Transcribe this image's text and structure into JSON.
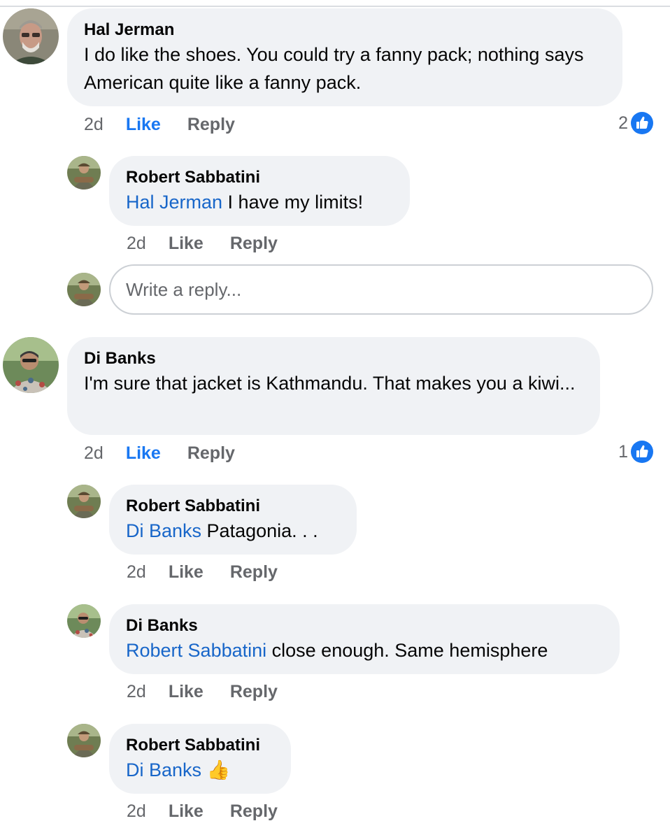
{
  "comments": [
    {
      "author": "Hal Jerman",
      "text": "I do like the shoes. You could try a fanny pack; nothing says American quite like a fanny pack.",
      "time": "2d",
      "like_label": "Like",
      "reply_label": "Reply",
      "reactions": "2",
      "replies": [
        {
          "author": "Robert Sabbatini",
          "mention": "Hal Jerman",
          "text": " I have my limits!",
          "time": "2d",
          "like_label": "Like",
          "reply_label": "Reply"
        }
      ],
      "reply_input_placeholder": "Write a reply..."
    },
    {
      "author": "Di Banks",
      "text": "I'm sure that jacket is Kathmandu. That makes you a kiwi...",
      "time": "2d",
      "like_label": "Like",
      "reply_label": "Reply",
      "reactions": "1",
      "replies": [
        {
          "author": "Robert Sabbatini",
          "mention": "Di Banks",
          "text": " Patagonia. . .",
          "time": "2d",
          "like_label": "Like",
          "reply_label": "Reply"
        },
        {
          "author": "Di Banks",
          "mention": "Robert Sabbatini",
          "text": " close enough. Same hemisphere",
          "time": "2d",
          "like_label": "Like",
          "reply_label": "Reply"
        },
        {
          "author": "Robert Sabbatini",
          "mention": "Di Banks",
          "text": " 👍",
          "time": "2d",
          "like_label": "Like",
          "reply_label": "Reply"
        }
      ]
    }
  ],
  "colors": {
    "like_active": "#1877f2",
    "mention": "#1866c9",
    "bubble": "#f0f2f5",
    "meta": "#65676b"
  },
  "icons": {
    "reaction": "thumbs-up-icon"
  }
}
